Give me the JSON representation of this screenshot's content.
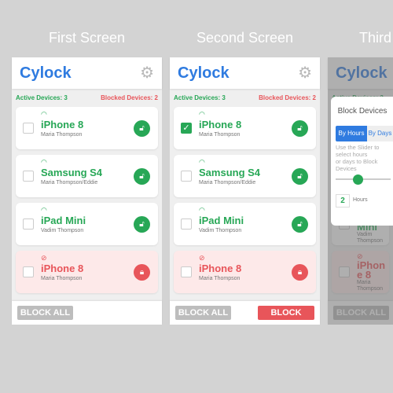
{
  "screens": [
    {
      "title": "First Screen",
      "selected": [
        false,
        false,
        false,
        false
      ],
      "show_block": false
    },
    {
      "title": "Second Screen",
      "selected": [
        true,
        false,
        false,
        false
      ],
      "show_block": true
    },
    {
      "title": "Third",
      "selected": [
        false,
        false,
        false,
        false
      ],
      "show_block": false
    }
  ],
  "app": {
    "logo": "Cylock",
    "active_label": "Active Devices: 3",
    "blocked_label": "Blocked Devices: 2",
    "block_all": "BLOCK ALL",
    "block": "BLOCK"
  },
  "devices": [
    {
      "name": "iPhone 8",
      "owner": "Maria Thompson",
      "status": "active"
    },
    {
      "name": "Samsung S4",
      "owner": "Maria Thompson/Eddie",
      "status": "active"
    },
    {
      "name": "iPad Mini",
      "owner": "Vadim Thompson",
      "status": "active"
    },
    {
      "name": "iPhone 8",
      "owner": "Maria Thompson",
      "status": "blocked"
    }
  ],
  "modal": {
    "title": "Block Devices",
    "tab_hours": "By Hours",
    "tab_days": "By Days",
    "help_line1": "Use the Slider to select hours",
    "help_line2": "or days to Block Devices",
    "slider_value": 2,
    "slider_fraction": 0.4,
    "unit": "Hours"
  },
  "colors": {
    "brand": "#2f7be0",
    "active": "#27a756",
    "blocked": "#e8555a"
  }
}
